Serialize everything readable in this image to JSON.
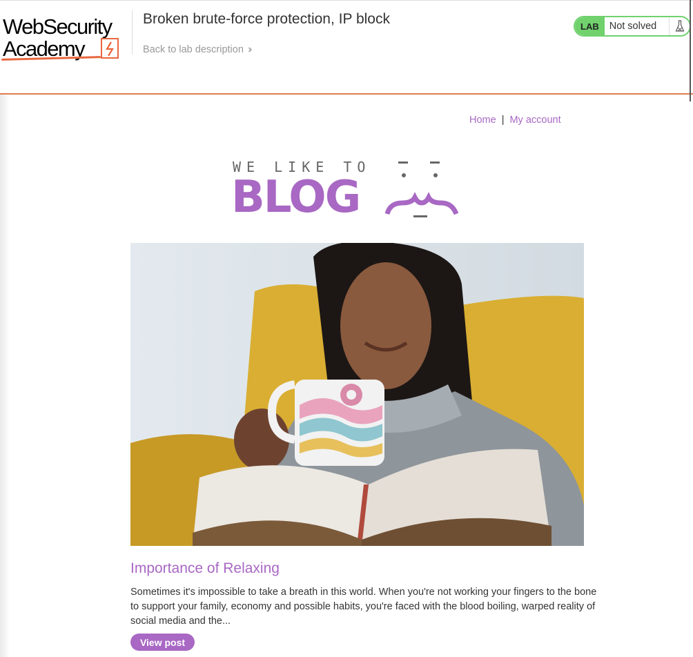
{
  "academy": {
    "logo_line1": "WebSecurity",
    "logo_line2": "Academy",
    "lab_title": "Broken brute-force protection, IP block",
    "back_link": "Back to lab description",
    "lab_badge": "LAB",
    "lab_status": "Not solved",
    "accent_color": "#e8663d",
    "status_color": "#70d16d"
  },
  "nav": {
    "home": "Home",
    "separator": "|",
    "my_account": "My account"
  },
  "blog_logo": {
    "tagline": "WE LIKE TO",
    "word": "BLOG"
  },
  "post": {
    "title": "Importance of Relaxing",
    "excerpt": "Sometimes it's impossible to take a breath in this world. When you're not working your fingers to the bone to support your family, economy and possible habits, you're faced with the blood boiling, warped reality of social media and the...",
    "button": "View post"
  },
  "theme": {
    "brand_purple": "#a868c3"
  }
}
